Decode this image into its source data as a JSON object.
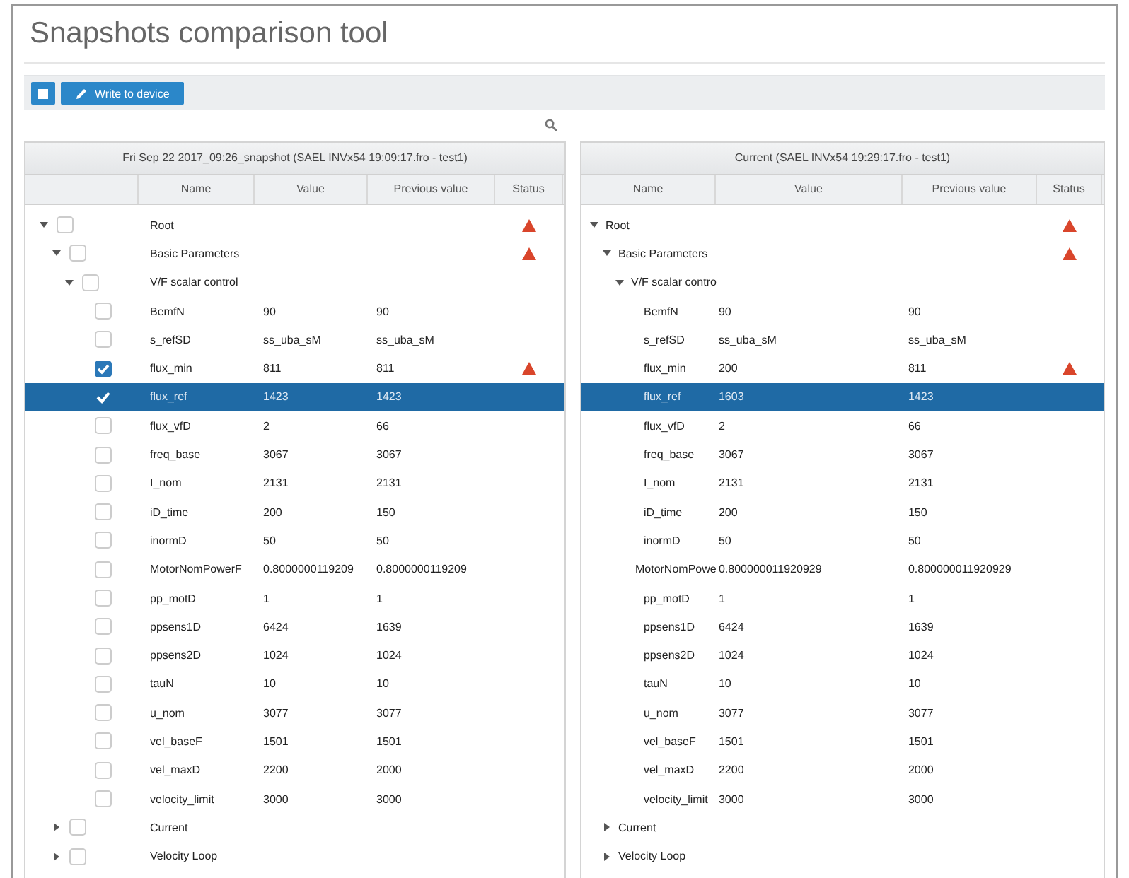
{
  "window": {
    "title": "Snapshots comparison tool"
  },
  "toolbar": {
    "buttons": [
      {
        "kind": "icon"
      },
      {
        "kind": "write",
        "label": "Write to device"
      }
    ]
  },
  "left": {
    "title": "Fri Sep 22 2017_09:26_snapshot (SAEL INVx54 19:09:17.fro - test1)",
    "columns": [
      "Name",
      "Value",
      "Previous value",
      "Status"
    ],
    "rows": [
      {
        "name": "Root",
        "expanded": true,
        "checked": false,
        "selected": false,
        "warning": true,
        "children": [
          {
            "name": "Basic Parameters",
            "expanded": true,
            "checked": false,
            "selected": false,
            "warning": true,
            "children": [
              {
                "name": "V/F scalar control",
                "expanded": true,
                "checked": false,
                "selected": false,
                "warning": false,
                "children": [
                  {
                    "name": "BemfN",
                    "value": "90",
                    "previous": "90",
                    "checked": false,
                    "selected": false,
                    "warning": false
                  },
                  {
                    "name": "s_refSD",
                    "value": "ss_uba_sM",
                    "previous": "ss_uba_sM",
                    "checked": false,
                    "selected": false,
                    "warning": false
                  },
                  {
                    "name": "flux_min",
                    "value": "811",
                    "previous": "811",
                    "checked": true,
                    "selected": false,
                    "warning": true
                  },
                  {
                    "name": "flux_ref",
                    "value": "1423",
                    "previous": "1423",
                    "checked": true,
                    "selected": true,
                    "warning": false
                  },
                  {
                    "name": "flux_vfD",
                    "value": "2",
                    "previous": "66",
                    "checked": false,
                    "selected": false,
                    "warning": false
                  },
                  {
                    "name": "freq_base",
                    "value": "3067",
                    "previous": "3067",
                    "checked": false,
                    "selected": false,
                    "warning": false
                  },
                  {
                    "name": "I_nom",
                    "value": "2131",
                    "previous": "2131",
                    "checked": false,
                    "selected": false,
                    "warning": false
                  },
                  {
                    "name": "iD_time",
                    "value": "200",
                    "previous": "150",
                    "checked": false,
                    "selected": false,
                    "warning": false
                  },
                  {
                    "name": "inormD",
                    "value": "50",
                    "previous": "50",
                    "checked": false,
                    "selected": false,
                    "warning": false
                  },
                  {
                    "name": "MotorNomPowerF",
                    "value": "0.8000000119209",
                    "previous": "0.8000000119209",
                    "checked": false,
                    "selected": false,
                    "warning": false
                  },
                  {
                    "name": "pp_motD",
                    "value": "1",
                    "previous": "1",
                    "checked": false,
                    "selected": false,
                    "warning": false
                  },
                  {
                    "name": "ppsens1D",
                    "value": "6424",
                    "previous": "1639",
                    "checked": false,
                    "selected": false,
                    "warning": false
                  },
                  {
                    "name": "ppsens2D",
                    "value": "1024",
                    "previous": "1024",
                    "checked": false,
                    "selected": false,
                    "warning": false
                  },
                  {
                    "name": "tauN",
                    "value": "10",
                    "previous": "10",
                    "checked": false,
                    "selected": false,
                    "warning": false
                  },
                  {
                    "name": "u_nom",
                    "value": "3077",
                    "previous": "3077",
                    "checked": false,
                    "selected": false,
                    "warning": false
                  },
                  {
                    "name": "vel_baseF",
                    "value": "1501",
                    "previous": "1501",
                    "checked": false,
                    "selected": false,
                    "warning": false
                  },
                  {
                    "name": "vel_maxD",
                    "value": "2200",
                    "previous": "2000",
                    "checked": false,
                    "selected": false,
                    "warning": false
                  },
                  {
                    "name": "velocity_limit",
                    "value": "3000",
                    "previous": "3000",
                    "checked": false,
                    "selected": false,
                    "warning": false
                  }
                ]
              }
            ]
          },
          {
            "name": "Current",
            "expanded": false,
            "checked": false,
            "selected": false,
            "warning": false
          },
          {
            "name": "Velocity Loop",
            "expanded": false,
            "checked": false,
            "selected": false,
            "warning": false
          }
        ]
      }
    ]
  },
  "right": {
    "title": "Current (SAEL INVx54 19:29:17.fro - test1)",
    "columns": [
      "Name",
      "Value",
      "Previous value",
      "Status"
    ],
    "rows": [
      {
        "name": "Root",
        "expanded": true,
        "selected": false,
        "warning": true,
        "children": [
          {
            "name": "Basic Parameters",
            "expanded": true,
            "selected": false,
            "warning": true,
            "children": [
              {
                "name": "V/F scalar contro",
                "expanded": true,
                "selected": false,
                "warning": false,
                "children": [
                  {
                    "name": "BemfN",
                    "value": "90",
                    "previous": "90",
                    "selected": false,
                    "warning": false
                  },
                  {
                    "name": "s_refSD",
                    "value": "ss_uba_sM",
                    "previous": "ss_uba_sM",
                    "selected": false,
                    "warning": false
                  },
                  {
                    "name": "flux_min",
                    "value": "200",
                    "previous": "811",
                    "selected": false,
                    "warning": true
                  },
                  {
                    "name": "flux_ref",
                    "value": "1603",
                    "previous": "1423",
                    "selected": true,
                    "warning": false
                  },
                  {
                    "name": "flux_vfD",
                    "value": "2",
                    "previous": "66",
                    "selected": false,
                    "warning": false
                  },
                  {
                    "name": "freq_base",
                    "value": "3067",
                    "previous": "3067",
                    "selected": false,
                    "warning": false
                  },
                  {
                    "name": "I_nom",
                    "value": "2131",
                    "previous": "2131",
                    "selected": false,
                    "warning": false
                  },
                  {
                    "name": "iD_time",
                    "value": "200",
                    "previous": "150",
                    "selected": false,
                    "warning": false
                  },
                  {
                    "name": "inormD",
                    "value": "50",
                    "previous": "50",
                    "selected": false,
                    "warning": false
                  },
                  {
                    "name": "MotorNomPowe",
                    "value": "0.800000011920929",
                    "previous": "0.800000011920929",
                    "selected": false,
                    "warning": false
                  },
                  {
                    "name": "pp_motD",
                    "value": "1",
                    "previous": "1",
                    "selected": false,
                    "warning": false
                  },
                  {
                    "name": "ppsens1D",
                    "value": "6424",
                    "previous": "1639",
                    "selected": false,
                    "warning": false
                  },
                  {
                    "name": "ppsens2D",
                    "value": "1024",
                    "previous": "1024",
                    "selected": false,
                    "warning": false
                  },
                  {
                    "name": "tauN",
                    "value": "10",
                    "previous": "10",
                    "selected": false,
                    "warning": false
                  },
                  {
                    "name": "u_nom",
                    "value": "3077",
                    "previous": "3077",
                    "selected": false,
                    "warning": false
                  },
                  {
                    "name": "vel_baseF",
                    "value": "1501",
                    "previous": "1501",
                    "selected": false,
                    "warning": false
                  },
                  {
                    "name": "vel_maxD",
                    "value": "2200",
                    "previous": "2000",
                    "selected": false,
                    "warning": false
                  },
                  {
                    "name": "velocity_limit",
                    "value": "3000",
                    "previous": "3000",
                    "selected": false,
                    "warning": false
                  }
                ]
              }
            ]
          },
          {
            "name": "Current",
            "expanded": false,
            "selected": false,
            "warning": false
          },
          {
            "name": "Velocity Loop",
            "expanded": false,
            "selected": false,
            "warning": false
          }
        ]
      }
    ]
  }
}
